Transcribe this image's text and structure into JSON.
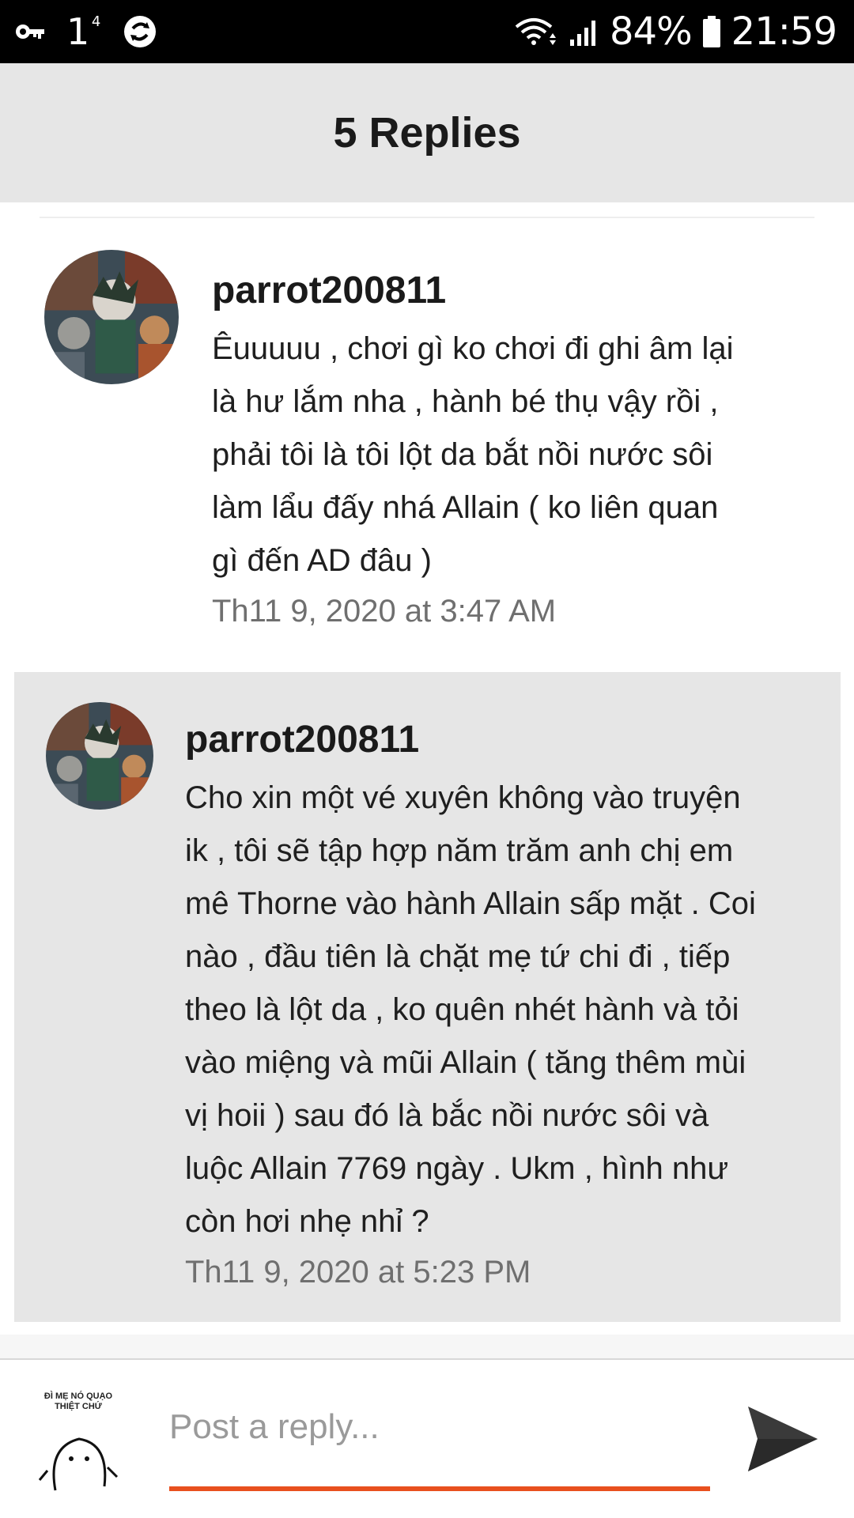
{
  "status_bar": {
    "notification_count": "1",
    "notification_sup": "4",
    "battery": "84%",
    "time": "21:59"
  },
  "header": {
    "title": "5 Replies"
  },
  "replies": [
    {
      "username": "parrot200811",
      "text": "Êuuuuu , chơi gì ko chơi đi ghi âm lại\nlà hư lắm nha , hành bé thụ vậy rồi ,\nphải tôi là tôi lột da bắt nồi nước sôi\nlàm lẩu đấy nhá Allain ( ko liên quan\ngì đến AD đâu )",
      "time": "Th11 9, 2020 at 3:47 AM"
    },
    {
      "username": "parrot200811",
      "text": "Cho xin một vé xuyên không vào truyện\nik , tôi sẽ tập hợp năm trăm anh chị em\nmê Thorne vào hành Allain sấp mặt . Coi\nnào , đầu tiên là chặt mẹ tứ chi đi , tiếp\ntheo là lột da , ko quên nhét hành và tỏi\nvào miệng và mũi Allain ( tăng thêm mùi\nvị hoii ) sau đó là bắc nồi nước sôi và\nluộc Allain 7769 ngày . Ukm , hình như\ncòn hơi nhẹ nhỉ ?",
      "time": "Th11 9, 2020 at 5:23 PM"
    }
  ],
  "composer": {
    "placeholder": "Post a reply...",
    "sticker_text": "ĐÌ MẸ NÓ QUẠO\nTHIỆT CHỨ",
    "accent_color": "#e8501e"
  }
}
